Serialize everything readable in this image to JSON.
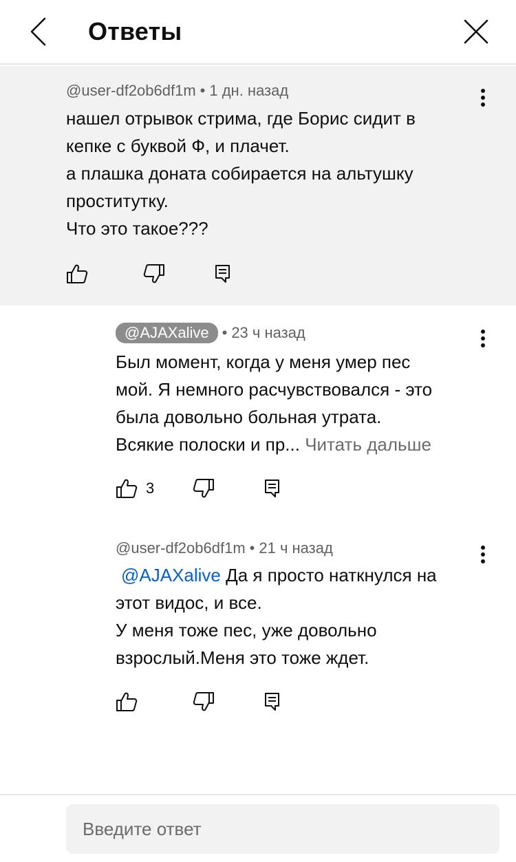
{
  "header": {
    "title": "Ответы",
    "back_icon": "chevron-left-icon",
    "close_icon": "close-icon"
  },
  "comments": [
    {
      "author": "@user-df2ob6df1m",
      "time": "1 дн. назад",
      "text": "нашел отрывок стрима, где Борис сидит в\nкепке с буквой Ф, и плачет.\nа плашка доната собирается на альтушку\nпроститутку.\nЧто это такое???",
      "likes": "",
      "highlighted": true
    },
    {
      "author": "@AJAXalive",
      "time": "23 ч назад",
      "text": "Был момент, когда у меня умер пес\nмой. Я немного расчувствовался - это\nбыла довольно больная утрата.\nВсякие полоски и пр... ",
      "read_more": "Читать дальше",
      "likes": "3",
      "author_is_creator_chip": true
    },
    {
      "author": "@user-df2ob6df1m",
      "time": "21 ч назад",
      "mention": "@AJAXalive",
      "text_after_mention": "  Да я просто наткнулся на\nэтот видос, и все.\nУ меня тоже пес, уже довольно\nвзрослый.Меня это тоже ждет.",
      "likes": ""
    }
  ],
  "reply": {
    "placeholder": "Введите ответ"
  },
  "colors": {
    "highlight_bg": "#f2f2f2",
    "mention": "#065fd4",
    "meta_text": "#606060",
    "chip_bg": "#8c8c8c"
  }
}
